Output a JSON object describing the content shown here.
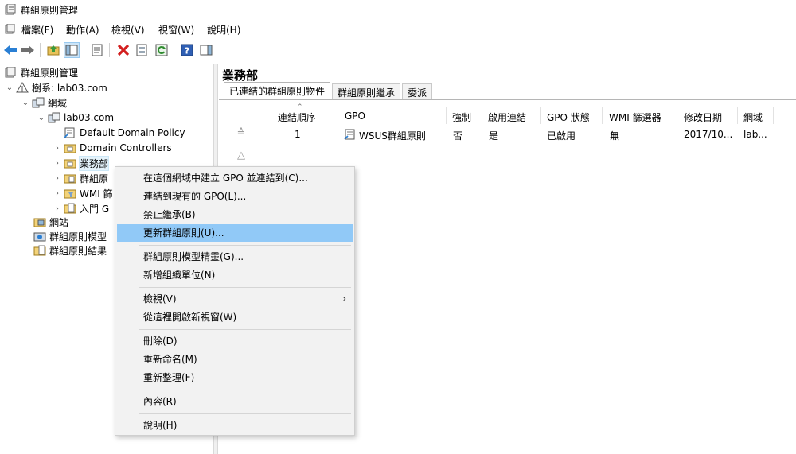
{
  "window": {
    "title": "群組原則管理"
  },
  "menubar": {
    "items": [
      "檔案(F)",
      "動作(A)",
      "檢視(V)",
      "視窗(W)",
      "說明(H)"
    ]
  },
  "toolbar": {
    "buttons": [
      "back-icon",
      "forward-icon",
      "up-folder-icon",
      "show-hide-tree-icon",
      "properties-icon",
      "delete-icon",
      "export-list-icon",
      "refresh-icon",
      "help-icon",
      "action-pane-icon"
    ]
  },
  "tree": {
    "root": "群組原則管理",
    "forest": "樹系: lab03.com",
    "domains": "網域",
    "domain": "lab03.com",
    "default_policy": "Default Domain Policy",
    "domain_controllers": "Domain Controllers",
    "ou_sales": "業務部",
    "gpo_objects": "群組原",
    "wmi_filters": "WMI 篩",
    "starter_gpo": "入門 G",
    "sites": "網站",
    "modeling": "群組原則模型",
    "results": "群組原則結果"
  },
  "right_pane": {
    "title": "業務部",
    "tabs": [
      "已連結的群組原則物件",
      "群組原則繼承",
      "委派"
    ],
    "columns": [
      "連結順序",
      "GPO",
      "強制",
      "啟用連結",
      "GPO 狀態",
      "WMI 篩選器",
      "修改日期",
      "網域"
    ],
    "rows": [
      {
        "order": "1",
        "gpo": "WSUS群組原則",
        "enforced": "否",
        "link_enabled": "是",
        "status": "已啟用",
        "wmi": "無",
        "modified": "2017/10...",
        "domain": "lab..."
      }
    ]
  },
  "context_menu": {
    "items": [
      "在這個網域中建立 GPO 並連結到(C)...",
      "連結到現有的 GPO(L)...",
      "禁止繼承(B)",
      "更新群組原則(U)...",
      "群組原則模型精靈(G)...",
      "新增組織單位(N)",
      "檢視(V)",
      "從這裡開啟新視窗(W)",
      "刪除(D)",
      "重新命名(M)",
      "重新整理(F)",
      "內容(R)",
      "說明(H)"
    ],
    "highlighted": "更新群組原則(U)..."
  },
  "colors": {
    "highlight": "#91c9f7",
    "selection": "#e5f3fb",
    "menu_bg": "#f2f2f2"
  }
}
